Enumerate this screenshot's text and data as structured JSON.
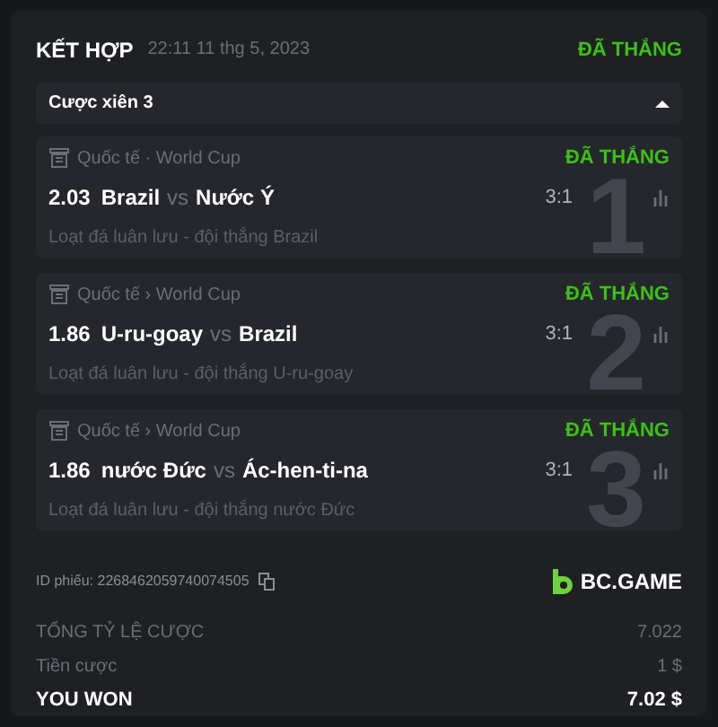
{
  "header": {
    "title": "KẾT HỢP",
    "datetime": "22:11 11 thg 5, 2023",
    "status": "ĐÃ THẮNG"
  },
  "parlay": {
    "label": "Cược xiên 3",
    "expanded": true
  },
  "legs": [
    {
      "number": "1",
      "league": "Quốc tế · World Cup",
      "status": "ĐÃ THẮNG",
      "odds": "2.03",
      "home": "Brazil",
      "vs": "vs",
      "away": "Nước Ý",
      "score": "3:1",
      "market": "Loạt đá luân lưu - đội thắng Brazil"
    },
    {
      "number": "2",
      "league": "Quốc tế › World Cup",
      "status": "ĐÃ THẮNG",
      "odds": "1.86",
      "home": "U-ru-goay",
      "vs": "vs",
      "away": "Brazil",
      "score": "3:1",
      "market": "Loạt đá luân lưu - đội thắng U-ru-goay"
    },
    {
      "number": "3",
      "league": "Quốc tế › World Cup",
      "status": "ĐÃ THẮNG",
      "odds": "1.86",
      "home": "nước Đức",
      "vs": "vs",
      "away": "Ác-hen-ti-na",
      "score": "3:1",
      "market": "Loạt đá luân lưu - đội thắng nước Đức"
    }
  ],
  "ticket_id": "ID phiếu: 2268462059740074505",
  "brand": "BC.GAME",
  "totals": [
    {
      "kind": "muted",
      "label": "TỔNG TỶ LỆ CƯỢC",
      "value": "7.022"
    },
    {
      "kind": "muted",
      "label": "Tiền cược",
      "value": "1 $"
    },
    {
      "kind": "strong",
      "label": "YOU WON",
      "value": "7.02 $"
    }
  ]
}
